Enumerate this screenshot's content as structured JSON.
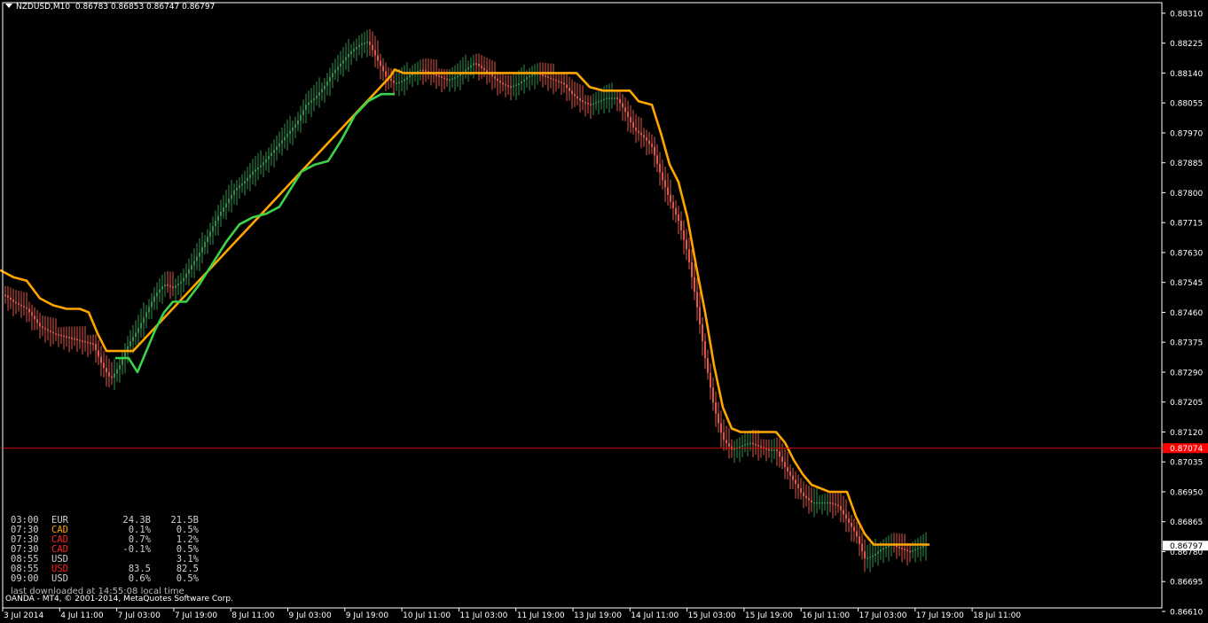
{
  "header": {
    "symbol_timeframe": "NZDUSD,M10",
    "quote": "0.86783 0.86853 0.86747 0.86797"
  },
  "colors": {
    "background": "#000000",
    "axis": "#ffffff",
    "up_bar": "#2f8f4a",
    "down_bar": "#e0564a",
    "ma_orange": "#ffa500",
    "ma_green": "#3cd24a",
    "hline_red": "#cc1100",
    "price_tag_red": "#ff0000"
  },
  "calendar": {
    "rows": [
      {
        "time": "03:00",
        "currency": "EUR",
        "currency_color": "#d0d0d0",
        "actual": "24.3B",
        "forecast": "21.5B"
      },
      {
        "time": "07:30",
        "currency": "CAD",
        "currency_color": "#ffa500",
        "actual": "0.1%",
        "forecast": "0.5%"
      },
      {
        "time": "07:30",
        "currency": "CAD",
        "currency_color": "#ff2020",
        "actual": "0.7%",
        "forecast": "1.2%"
      },
      {
        "time": "07:30",
        "currency": "CAD",
        "currency_color": "#ff2020",
        "actual": "-0.1%",
        "forecast": "0.5%"
      },
      {
        "time": "08:55",
        "currency": "USD",
        "currency_color": "#d0d0d0",
        "actual": "",
        "forecast": "3.1%"
      },
      {
        "time": "08:55",
        "currency": "USD",
        "currency_color": "#ff2020",
        "actual": "83.5",
        "forecast": "82.5"
      },
      {
        "time": "09:00",
        "currency": "USD",
        "currency_color": "#d0d0d0",
        "actual": "0.6%",
        "forecast": "0.5%"
      }
    ],
    "download_note": "last downloaded at 14:55:08 local time"
  },
  "footer": {
    "copyright": "OANDA - MT4, © 2001-2014, MetaQuotes Software Corp."
  },
  "chart_data": {
    "type": "candlestick",
    "symbol": "NZDUSD",
    "timeframe": "M10",
    "y_range": [
      0.8662,
      0.8834
    ],
    "y_ticks": [
      "0.88310",
      "0.88225",
      "0.88140",
      "0.88055",
      "0.87970",
      "0.87885",
      "0.87800",
      "0.87715",
      "0.87630",
      "0.87545",
      "0.87460",
      "0.87375",
      "0.87290",
      "0.87205",
      "0.87120",
      "0.87035",
      "0.86950",
      "0.86865",
      "0.86780",
      "0.86695",
      "0.86610"
    ],
    "x_ticks": [
      "3 Jul 2014",
      "4 Jul 11:00",
      "7 Jul 03:00",
      "7 Jul 19:00",
      "8 Jul 11:00",
      "9 Jul 03:00",
      "9 Jul 19:00",
      "10 Jul 11:00",
      "11 Jul 03:00",
      "11 Jul 19:00",
      "13 Jul 19:00",
      "14 Jul 11:00",
      "15 Jul 03:00",
      "15 Jul 19:00",
      "16 Jul 11:00",
      "17 Jul 03:00",
      "17 Jul 19:00",
      "18 Jul 11:00"
    ],
    "current_price": "0.86797",
    "horizontal_line": {
      "price": 0.87074,
      "label": "0.87074"
    },
    "close_path": [
      [
        0,
        0.8752
      ],
      [
        15,
        0.8749
      ],
      [
        30,
        0.8747
      ],
      [
        45,
        0.8742
      ],
      [
        60,
        0.874
      ],
      [
        75,
        0.8739
      ],
      [
        90,
        0.8738
      ],
      [
        105,
        0.8737
      ],
      [
        115,
        0.8731
      ],
      [
        125,
        0.8727
      ],
      [
        135,
        0.8731
      ],
      [
        145,
        0.8737
      ],
      [
        155,
        0.8741
      ],
      [
        165,
        0.8746
      ],
      [
        175,
        0.8751
      ],
      [
        185,
        0.8754
      ],
      [
        195,
        0.8753
      ],
      [
        205,
        0.8755
      ],
      [
        215,
        0.8759
      ],
      [
        225,
        0.8763
      ],
      [
        235,
        0.8768
      ],
      [
        245,
        0.8773
      ],
      [
        255,
        0.8777
      ],
      [
        265,
        0.8781
      ],
      [
        275,
        0.8783
      ],
      [
        285,
        0.8786
      ],
      [
        295,
        0.8788
      ],
      [
        305,
        0.8791
      ],
      [
        315,
        0.8794
      ],
      [
        325,
        0.8797
      ],
      [
        335,
        0.88
      ],
      [
        345,
        0.8805
      ],
      [
        355,
        0.8807
      ],
      [
        365,
        0.881
      ],
      [
        375,
        0.8814
      ],
      [
        385,
        0.8817
      ],
      [
        395,
        0.882
      ],
      [
        405,
        0.8822
      ],
      [
        415,
        0.8823
      ],
      [
        425,
        0.8818
      ],
      [
        435,
        0.8813
      ],
      [
        445,
        0.8811
      ],
      [
        455,
        0.8812
      ],
      [
        465,
        0.8814
      ],
      [
        475,
        0.8815
      ],
      [
        485,
        0.8814
      ],
      [
        495,
        0.8813
      ],
      [
        505,
        0.8812
      ],
      [
        515,
        0.8813
      ],
      [
        525,
        0.8815
      ],
      [
        535,
        0.8817
      ],
      [
        545,
        0.8815
      ],
      [
        555,
        0.8813
      ],
      [
        565,
        0.8811
      ],
      [
        575,
        0.881
      ],
      [
        585,
        0.8811
      ],
      [
        595,
        0.8813
      ],
      [
        605,
        0.8814
      ],
      [
        615,
        0.8813
      ],
      [
        625,
        0.8812
      ],
      [
        635,
        0.8811
      ],
      [
        645,
        0.8808
      ],
      [
        655,
        0.8806
      ],
      [
        665,
        0.8805
      ],
      [
        675,
        0.8806
      ],
      [
        685,
        0.8807
      ],
      [
        695,
        0.8807
      ],
      [
        705,
        0.8803
      ],
      [
        715,
        0.8798
      ],
      [
        725,
        0.8796
      ],
      [
        735,
        0.8793
      ],
      [
        745,
        0.8785
      ],
      [
        755,
        0.8778
      ],
      [
        765,
        0.8772
      ],
      [
        775,
        0.8763
      ],
      [
        785,
        0.8749
      ],
      [
        795,
        0.8733
      ],
      [
        805,
        0.8719
      ],
      [
        815,
        0.871
      ],
      [
        825,
        0.8707
      ],
      [
        835,
        0.8708
      ],
      [
        845,
        0.8709
      ],
      [
        855,
        0.8708
      ],
      [
        865,
        0.8707
      ],
      [
        875,
        0.8707
      ],
      [
        885,
        0.8702
      ],
      [
        895,
        0.8698
      ],
      [
        905,
        0.8694
      ],
      [
        915,
        0.8692
      ],
      [
        925,
        0.8692
      ],
      [
        935,
        0.8692
      ],
      [
        945,
        0.8691
      ],
      [
        955,
        0.8687
      ],
      [
        965,
        0.8683
      ],
      [
        975,
        0.8676
      ],
      [
        985,
        0.8677
      ],
      [
        995,
        0.8679
      ],
      [
        1005,
        0.868
      ],
      [
        1015,
        0.8679
      ],
      [
        1025,
        0.8678
      ],
      [
        1035,
        0.8679
      ],
      [
        1045,
        0.868
      ]
    ],
    "orange_line": [
      [
        0,
        0.8758
      ],
      [
        15,
        0.8756
      ],
      [
        30,
        0.8755
      ],
      [
        45,
        0.875
      ],
      [
        60,
        0.8748
      ],
      [
        75,
        0.8747
      ],
      [
        90,
        0.8747
      ],
      [
        100,
        0.8746
      ],
      [
        110,
        0.874
      ],
      [
        120,
        0.8735
      ],
      [
        135,
        0.8735
      ],
      [
        150,
        0.8735
      ],
      [
        440,
        0.8813
      ],
      [
        445,
        0.8815
      ],
      [
        455,
        0.8814
      ],
      [
        465,
        0.8814
      ],
      [
        650,
        0.8814
      ],
      [
        665,
        0.881
      ],
      [
        680,
        0.8809
      ],
      [
        710,
        0.8809
      ],
      [
        720,
        0.8806
      ],
      [
        735,
        0.8805
      ],
      [
        745,
        0.8797
      ],
      [
        755,
        0.8788
      ],
      [
        765,
        0.8783
      ],
      [
        775,
        0.8773
      ],
      [
        785,
        0.8759
      ],
      [
        795,
        0.8746
      ],
      [
        805,
        0.8731
      ],
      [
        815,
        0.8719
      ],
      [
        825,
        0.8713
      ],
      [
        835,
        0.8712
      ],
      [
        875,
        0.8712
      ],
      [
        885,
        0.8709
      ],
      [
        895,
        0.8704
      ],
      [
        905,
        0.87
      ],
      [
        915,
        0.8697
      ],
      [
        925,
        0.8696
      ],
      [
        935,
        0.8695
      ],
      [
        955,
        0.8695
      ],
      [
        965,
        0.8688
      ],
      [
        975,
        0.8683
      ],
      [
        985,
        0.868
      ],
      [
        1000,
        0.868
      ],
      [
        1048,
        0.868
      ]
    ],
    "green_line": [
      [
        130,
        0.8733
      ],
      [
        145,
        0.8733
      ],
      [
        155,
        0.8729
      ],
      [
        165,
        0.8735
      ],
      [
        175,
        0.8741
      ],
      [
        185,
        0.8746
      ],
      [
        195,
        0.8749
      ],
      [
        210,
        0.8749
      ],
      [
        225,
        0.8754
      ],
      [
        240,
        0.876
      ],
      [
        255,
        0.8766
      ],
      [
        270,
        0.8771
      ],
      [
        285,
        0.8773
      ],
      [
        300,
        0.8774
      ],
      [
        315,
        0.8776
      ],
      [
        330,
        0.8782
      ],
      [
        340,
        0.8786
      ],
      [
        355,
        0.8788
      ],
      [
        370,
        0.8789
      ],
      [
        385,
        0.8795
      ],
      [
        400,
        0.8802
      ],
      [
        415,
        0.8806
      ],
      [
        430,
        0.8808
      ],
      [
        445,
        0.8808
      ]
    ]
  }
}
